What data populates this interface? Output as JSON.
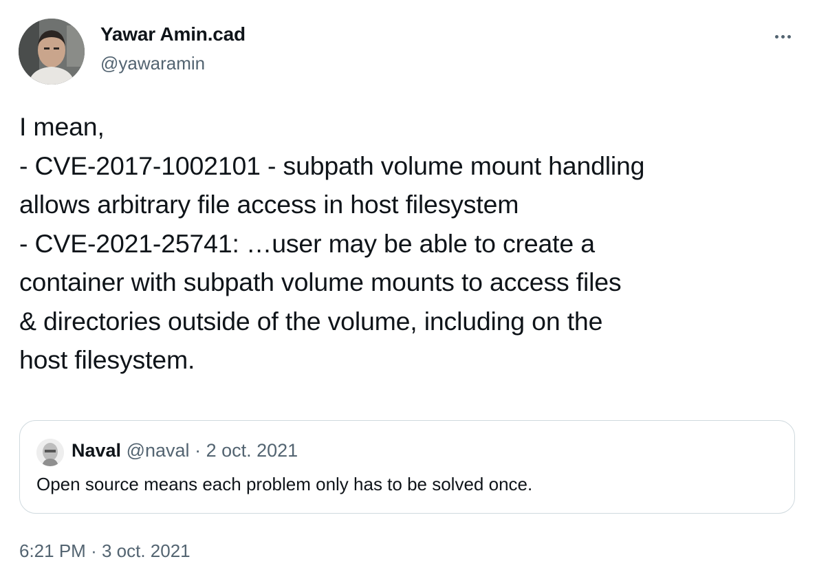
{
  "author": {
    "name": "Yawar Amin.cad",
    "handle": "@yawaramin"
  },
  "more_button": {
    "icon": "more-horizontal-icon"
  },
  "tweet_lines": [
    "I mean,",
    "- CVE-2017-1002101 - subpath volume mount handling",
    "allows arbitrary file access in host filesystem",
    "- CVE-2021-25741: …user may be able to create a",
    "container with subpath volume mounts to access files",
    "& directories outside of the volume, including on the",
    "host filesystem."
  ],
  "quote": {
    "name": "Naval",
    "handle": "@naval",
    "separator": "·",
    "date": "2 oct. 2021",
    "text": "Open source means each problem only has to be solved once."
  },
  "timestamp": {
    "time": "6:21 PM",
    "separator": "·",
    "date": "3 oct. 2021"
  },
  "colors": {
    "text": "#0f1419",
    "secondary": "#536471",
    "border": "#cfd9de"
  }
}
